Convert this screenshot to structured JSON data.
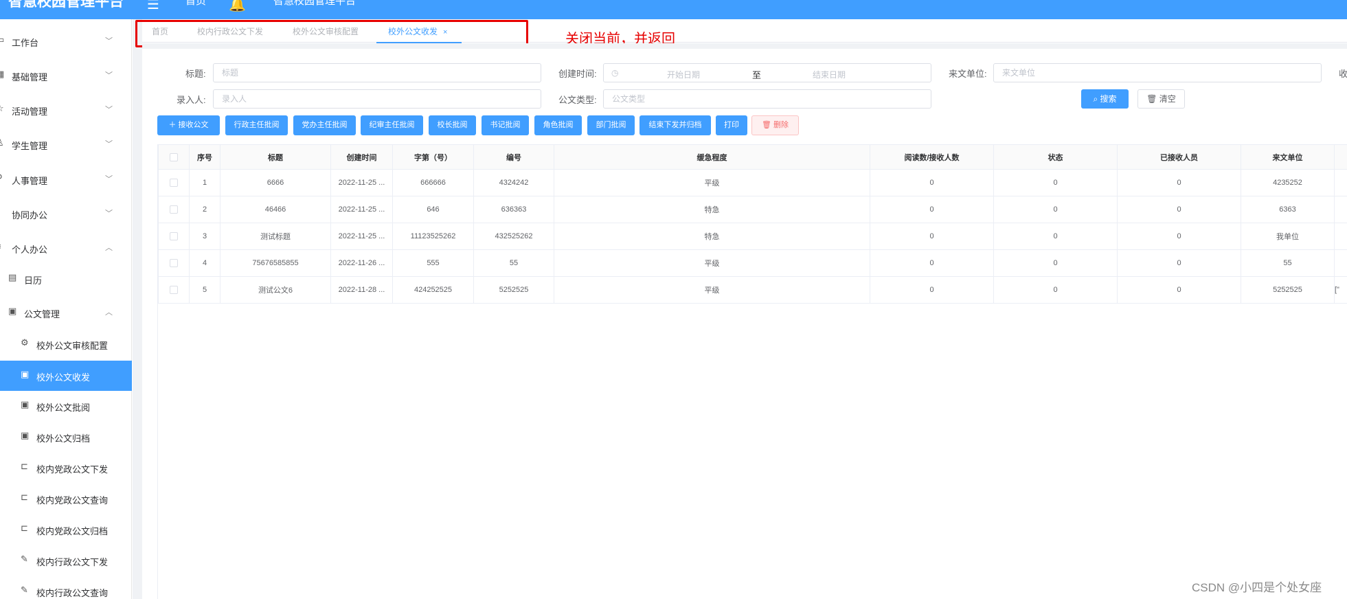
{
  "header": {
    "brand": "智慧校园管理平台",
    "nav_home": "首页",
    "nav_title": "智慧校园管理平台"
  },
  "sidebar": {
    "items": [
      {
        "label": "工作台",
        "icon": "monitor-icon",
        "arrow": "﹀"
      },
      {
        "label": "基础管理",
        "icon": "grid-icon",
        "arrow": "﹀"
      },
      {
        "label": "活动管理",
        "icon": "star-icon",
        "arrow": "﹀"
      },
      {
        "label": "学生管理",
        "icon": "user-icon",
        "arrow": "﹀"
      },
      {
        "label": "人事管理",
        "icon": "person-icon",
        "arrow": "﹀"
      },
      {
        "label": "协同办公",
        "icon": "share-icon",
        "arrow": "﹀"
      },
      {
        "label": "个人办公",
        "icon": "doc-icon",
        "arrow": "︿"
      }
    ],
    "sub_items": [
      {
        "label": "日历",
        "icon": "calendar-icon"
      },
      {
        "label": "公文管理",
        "icon": "folder-icon",
        "arrow": "︿"
      }
    ],
    "leaf_items": [
      {
        "label": "校外公文审核配置",
        "icon": "gear-icon",
        "active": false
      },
      {
        "label": "校外公文收发",
        "icon": "folder-icon",
        "active": true
      },
      {
        "label": "校外公文批阅",
        "icon": "folder-icon",
        "active": false
      },
      {
        "label": "校外公文归档",
        "icon": "folder-icon",
        "active": false
      },
      {
        "label": "校内党政公文下发",
        "icon": "send-icon",
        "active": false
      },
      {
        "label": "校内党政公文查询",
        "icon": "send-icon",
        "active": false
      },
      {
        "label": "校内党政公文归档",
        "icon": "send-icon",
        "active": false
      },
      {
        "label": "校内行政公文下发",
        "icon": "edit-icon",
        "active": false
      },
      {
        "label": "校内行政公文查询",
        "icon": "edit-icon",
        "active": false
      }
    ]
  },
  "tabs": [
    {
      "label": "首页",
      "active": false
    },
    {
      "label": "校内行政公文下发",
      "active": false
    },
    {
      "label": "校外公文审核配置",
      "active": false
    },
    {
      "label": "校外公文收发",
      "active": true,
      "close": "×"
    }
  ],
  "annotation": "关闭当前，并返回",
  "filters": {
    "title_label": "标题:",
    "title_placeholder": "标题",
    "created_label": "创建时间:",
    "date_start": "开始日期",
    "date_sep": "至",
    "date_end": "结束日期",
    "sender_label": "来文单位:",
    "sender_placeholder": "来文单位",
    "receiver_label_partial": "收",
    "entry_label": "录入人:",
    "entry_placeholder": "录入人",
    "type_label": "公文类型:",
    "type_placeholder": "公文类型",
    "search_button": "搜索",
    "clear_button": "清空"
  },
  "toolbar": {
    "receive": "接收公文",
    "buttons": [
      "行政主任批阅",
      "党办主任批阅",
      "纪审主任批阅",
      "校长批阅",
      "书记批阅",
      "角色批阅",
      "部门批阅",
      "结束下发并归档",
      "打印"
    ],
    "delete": "删除"
  },
  "table": {
    "columns": [
      "",
      "序号",
      "标题",
      "创建时间",
      "字第（号）",
      "编号",
      "缓急程度",
      "阅读数/接收人数",
      "状态",
      "已接收人员",
      "来文单位",
      ""
    ],
    "rows": [
      {
        "no": "1",
        "title": "6666",
        "created": "2022-11-25 ...",
        "zidi": "666666",
        "code": "4324242",
        "urgency": "平级",
        "read": "0",
        "status": "0",
        "received": "0",
        "sender": "4235252",
        "extra": ""
      },
      {
        "no": "2",
        "title": "46466",
        "created": "2022-11-25 ...",
        "zidi": "646",
        "code": "636363",
        "urgency": "特急",
        "read": "0",
        "status": "0",
        "received": "0",
        "sender": "6363",
        "extra": ""
      },
      {
        "no": "3",
        "title": "测试标题",
        "created": "2022-11-25 ...",
        "zidi": "11123525262",
        "code": "432525262",
        "urgency": "特急",
        "read": "0",
        "status": "0",
        "received": "0",
        "sender": "我单位",
        "extra": ""
      },
      {
        "no": "4",
        "title": "75676585855",
        "created": "2022-11-26 ...",
        "zidi": "555",
        "code": "55",
        "urgency": "平级",
        "read": "0",
        "status": "0",
        "received": "0",
        "sender": "55",
        "extra": ""
      },
      {
        "no": "5",
        "title": "测试公文6",
        "created": "2022-11-28 ...",
        "zidi": "424252525",
        "code": "5252525",
        "urgency": "平级",
        "read": "0",
        "status": "0",
        "received": "0",
        "sender": "5252525",
        "extra": "[\""
      }
    ]
  },
  "watermark": "CSDN @小四是个处女座",
  "colors": {
    "primary": "#409eff",
    "annotation": "#e60000",
    "danger": "#f56c6c"
  }
}
